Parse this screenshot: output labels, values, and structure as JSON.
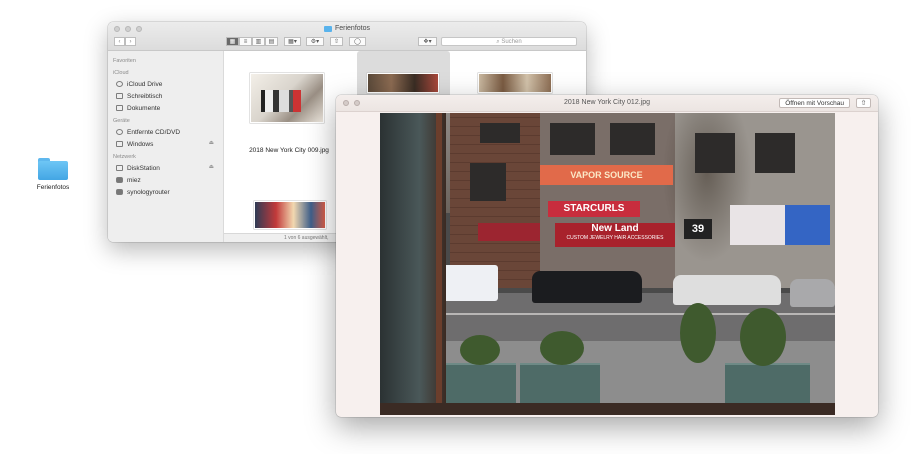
{
  "desktop": {
    "folder_label": "Ferienfotos"
  },
  "finder": {
    "title": "Ferienfotos",
    "search_placeholder": "Suchen",
    "sidebar": {
      "sections": [
        {
          "heading": "Favoriten",
          "items": []
        },
        {
          "heading": "iCloud",
          "items": [
            {
              "label": "iCloud Drive",
              "icon": "cloud-icon"
            },
            {
              "label": "Schreibtisch",
              "icon": "desktop-icon"
            },
            {
              "label": "Dokumente",
              "icon": "document-icon"
            }
          ]
        },
        {
          "heading": "Geräte",
          "items": [
            {
              "label": "Entfernte CD/DVD",
              "icon": "disc-icon"
            },
            {
              "label": "Windows",
              "icon": "display-icon",
              "eject": true
            }
          ]
        },
        {
          "heading": "Netzwerk",
          "items": [
            {
              "label": "DiskStation",
              "icon": "display-icon",
              "eject": true
            },
            {
              "label": "miez",
              "icon": "server-icon"
            },
            {
              "label": "synologyrouter",
              "icon": "server-icon"
            }
          ]
        }
      ]
    },
    "files": [
      {
        "label": "2018 New York City 009.jpg"
      }
    ],
    "status": "1 von 6 ausgewählt,"
  },
  "preview": {
    "title": "2018 New York City 012.jpg",
    "open_button": "Öffnen mit Vorschau",
    "signs": {
      "vapor": "VAPOR SOURCE",
      "starcurls": "STARCURLS",
      "newland": "New Land",
      "newland_sub": "CUSTOM JEWELRY HAIR ACCESSORIES",
      "number": "39"
    }
  }
}
